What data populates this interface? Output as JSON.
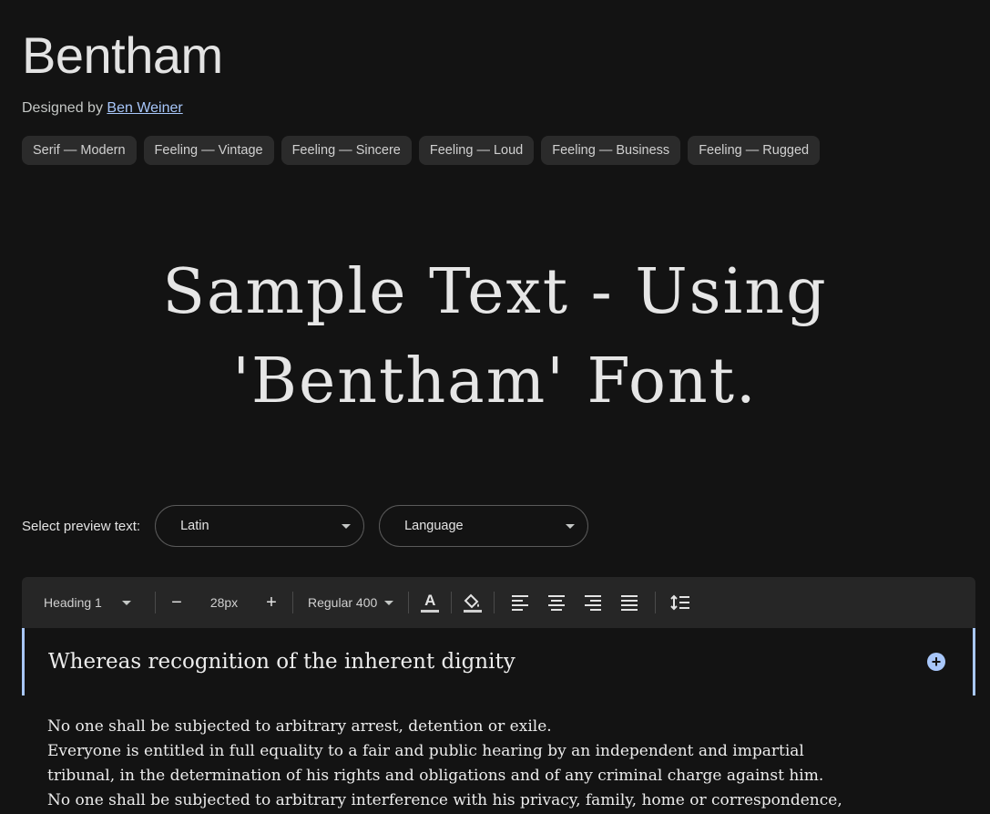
{
  "font": {
    "name": "Bentham",
    "designed_by_label": "Designed by",
    "designer": "Ben Weiner"
  },
  "tags": [
    "Serif — Modern",
    "Feeling — Vintage",
    "Feeling — Sincere",
    "Feeling — Loud",
    "Feeling — Business",
    "Feeling — Rugged"
  ],
  "sample_text": {
    "line1": "Sample Text - Using",
    "line2": "'Bentham' Font."
  },
  "preview": {
    "label": "Select preview text:",
    "script_select": "Latin",
    "language_select": "Language"
  },
  "toolbar": {
    "style": "Heading 1",
    "decrease": "−",
    "size": "28px",
    "increase": "+",
    "weight": "Regular 400",
    "text_color_icon": "A"
  },
  "editor": {
    "heading": "Whereas recognition of the inherent dignity",
    "body_lines": [
      "No one shall be subjected to arbitrary arrest, detention or exile.",
      "Everyone is entitled in full equality to a fair and public hearing by an independent and impartial",
      "tribunal, in the determination of his rights and obligations and of any criminal charge against him.",
      "No one shall be subjected to arbitrary interference with his privacy, family, home or correspondence,"
    ]
  },
  "colors": {
    "background": "#131313",
    "accent": "#a8c7fa",
    "toolbar_bg": "#262626"
  }
}
